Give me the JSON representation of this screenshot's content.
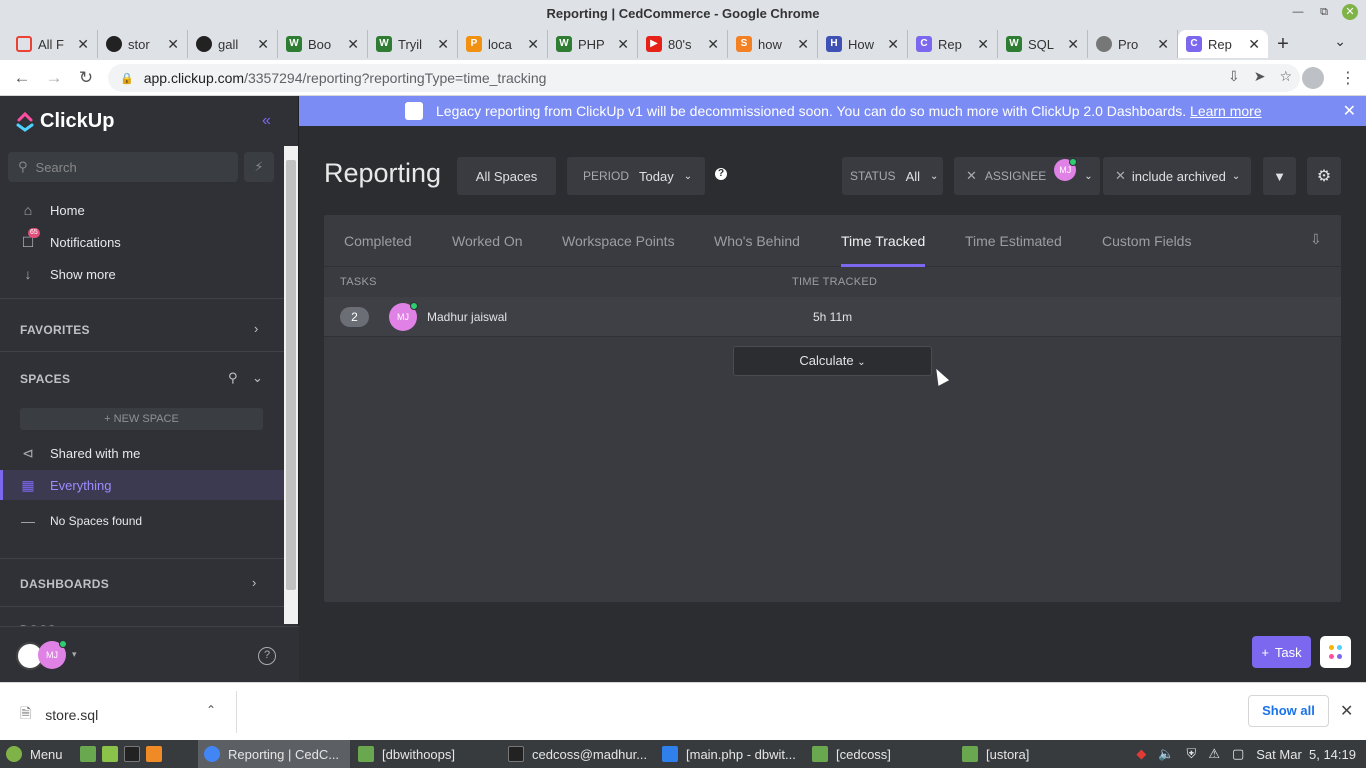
{
  "window": {
    "title": "Reporting | CedCommerce - Google Chrome"
  },
  "tabs": [
    {
      "label": "All F",
      "icon": "google-icon"
    },
    {
      "label": "stor",
      "icon": "github-icon"
    },
    {
      "label": "gall",
      "icon": "github-icon"
    },
    {
      "label": "Boo",
      "icon": "w3schools-icon"
    },
    {
      "label": "Tryil",
      "icon": "w3schools-icon"
    },
    {
      "label": "loca",
      "icon": "phpmyadmin-icon"
    },
    {
      "label": "PHP",
      "icon": "w3schools-icon"
    },
    {
      "label": "80's",
      "icon": "youtube-icon"
    },
    {
      "label": "how",
      "icon": "stackoverflow-icon"
    },
    {
      "label": "How",
      "icon": "site-icon"
    },
    {
      "label": "Rep",
      "icon": "clickup-icon"
    },
    {
      "label": "SQL",
      "icon": "w3schools-icon"
    },
    {
      "label": "Pro",
      "icon": "globe-icon"
    },
    {
      "label": "Rep",
      "icon": "clickup-icon",
      "active": true
    }
  ],
  "address": {
    "host": "app.clickup.com",
    "path": "/3357294/reporting?reportingType=time_tracking"
  },
  "sidebar": {
    "brand": "ClickUp",
    "search_placeholder": "Search",
    "nav": {
      "home": "Home",
      "notifications": "Notifications",
      "notifications_count": "65",
      "show_more": "Show more"
    },
    "favorites": "FAVORITES",
    "spaces": "SPACES",
    "new_space": "+ NEW SPACE",
    "shared": "Shared with me",
    "everything": "Everything",
    "no_spaces": "No Spaces found",
    "dashboards": "DASHBOARDS",
    "docs_partial": "DOCS",
    "user_initials": "MJ"
  },
  "banner": {
    "text": "Legacy reporting from ClickUp v1 will be decommissioned soon. You can do so much more with ClickUp 2.0 Dashboards.",
    "link": "Learn more"
  },
  "reporting": {
    "title": "Reporting",
    "all_spaces": "All Spaces",
    "period_label": "PERIOD",
    "period_value": "Today",
    "status_label": "STATUS",
    "status_value": "All",
    "assignee_label": "ASSIGNEE",
    "assignee_initials": "MJ",
    "archived": "include archived",
    "tabs": [
      "Completed",
      "Worked On",
      "Workspace Points",
      "Who's Behind",
      "Time Tracked",
      "Time Estimated",
      "Custom Fields"
    ],
    "active_tab": "Time Tracked",
    "col_tasks": "TASKS",
    "col_time": "TIME TRACKED",
    "rows": [
      {
        "count": "2",
        "initials": "MJ",
        "name": "Madhur jaiswal",
        "time": "5h 11m"
      }
    ],
    "calculate": "Calculate",
    "task_button": "Task"
  },
  "downloads": {
    "file": "store.sql",
    "show_all": "Show all"
  },
  "taskbar": {
    "menu": "Menu",
    "items": [
      "Reporting | CedC...",
      "[dbwithoops]",
      "cedcoss@madhur...",
      "[main.php - dbwit...",
      "[cedcoss]",
      "[ustora]"
    ],
    "clock": "Sat Mar  5, 14:19"
  },
  "colors": {
    "accent": "#7b68ee",
    "banner": "#7b8cf4",
    "online": "#2ecd6f",
    "avatar": "#e081e6"
  }
}
